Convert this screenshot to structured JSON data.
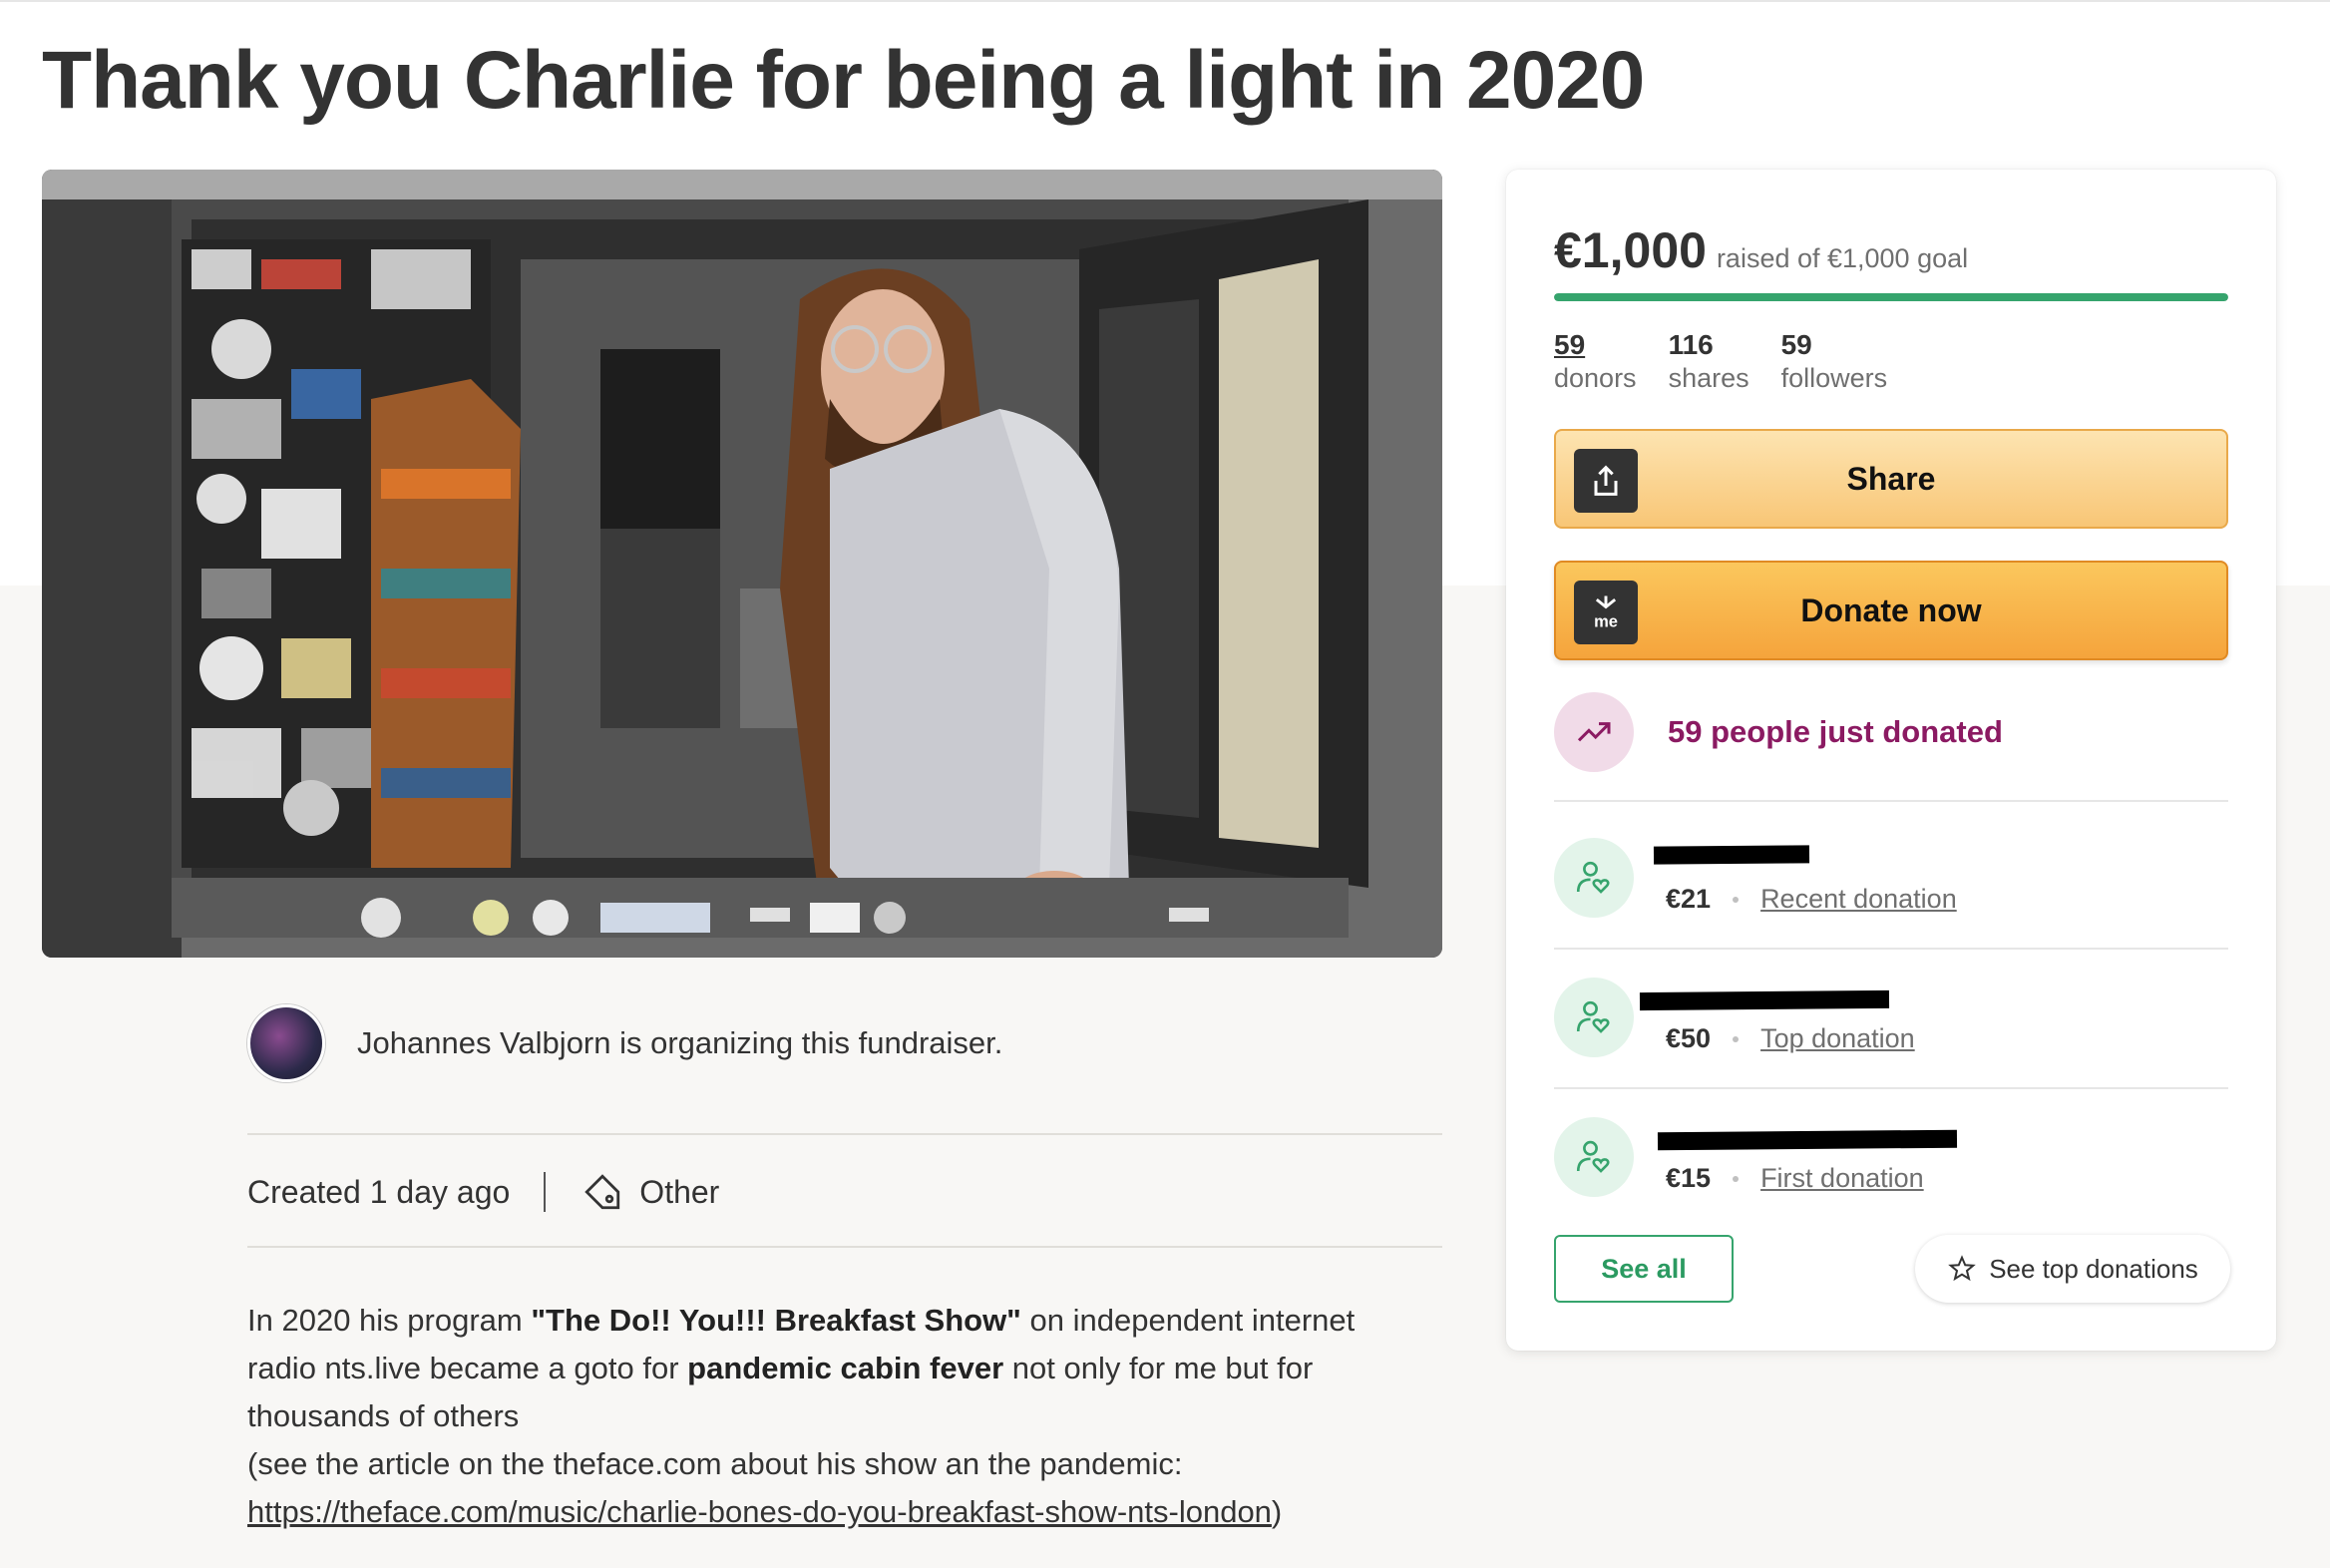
{
  "page": {
    "title": "Thank you Charlie for being a light in 2020"
  },
  "organizer": {
    "text": "Johannes Valbjorn is organizing this fundraiser."
  },
  "meta": {
    "created": "Created 1 day ago",
    "category": "Other"
  },
  "story": {
    "p1_a": "In 2020 his program ",
    "p1_show": "\"The Do!! You!!! Breakfast Show\"",
    "p1_b": " on independent internet radio nts.live became a goto for ",
    "p1_bold2": "pandemic cabin fever",
    "p1_c": " not only for me but for thousands of others",
    "p2": "(see the article on the theface.com about his show an the pandemic:",
    "link": "https://theface.com/music/charlie-bones-do-you-breakfast-show-nts-london",
    "link_close": ")"
  },
  "card": {
    "raised_amount": "€1,000",
    "raised_goal": "raised of €1,000 goal",
    "progress_fraction": 1.0,
    "progress_color": "#36a46d",
    "stats": [
      {
        "num": "59",
        "label": "donors"
      },
      {
        "num": "116",
        "label": "shares"
      },
      {
        "num": "59",
        "label": "followers"
      }
    ],
    "share_label": "Share",
    "donate_label": "Donate now",
    "donate_icon_text": "me",
    "trend_text": "59 people just donated",
    "donations": [
      {
        "amount": "€21",
        "type": "Recent donation"
      },
      {
        "amount": "€50",
        "type": "Top donation"
      },
      {
        "amount": "€15",
        "type": "First donation"
      }
    ],
    "see_all": "See all",
    "see_top": "See top donations"
  },
  "colors": {
    "accent_green": "#36a46d",
    "trend_purple": "#8b1a62",
    "donate_orange": "#f5a43c"
  }
}
